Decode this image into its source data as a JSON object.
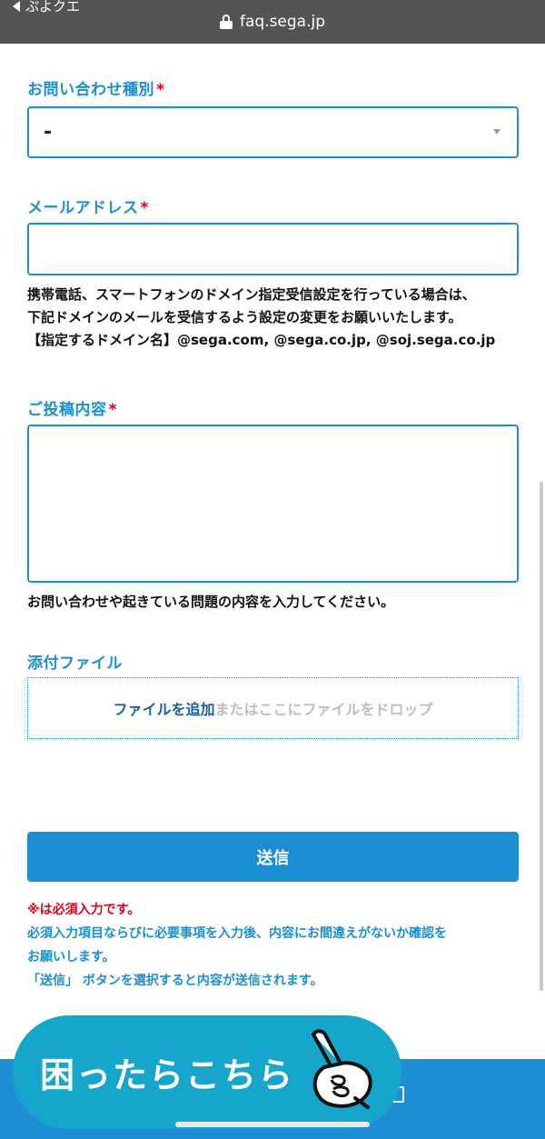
{
  "browser": {
    "back_label": "ぷよクエ",
    "url": "faq.sega.jp"
  },
  "form": {
    "inquiry_type": {
      "label": "お問い合わせ種別",
      "required_mark": "*",
      "selected_value": "-"
    },
    "email": {
      "label": "メールアドレス",
      "required_mark": "*",
      "value": "",
      "help_lines": [
        "携帯電話、スマートフォンのドメイン指定受信設定を行っている場合は、",
        "下記ドメインのメールを受信するよう設定の変更をお願いいたします。",
        "【指定するドメイン名】@sega.com, @sega.co.jp, @soj.sega.co.jp"
      ]
    },
    "message": {
      "label": "ご投稿内容",
      "required_mark": "*",
      "value": "",
      "help": "お問い合わせや起きている問題の内容を入力してください。"
    },
    "attachment": {
      "label": "添付ファイル",
      "add_link": "ファイルを追加",
      "drop_hint": "またはここにファイルをドロップ"
    },
    "submit_label": "送信"
  },
  "notes": {
    "required_note": "※は必須入力です。",
    "line2": "必須入力項目ならびに必要事項を入力後、内容にお間違えがないか確認を",
    "line3": "お願いします。",
    "line4": "「送信」 ボタンを選択すると内容が送信されます。"
  },
  "help_widget": {
    "label": "困ったらこちら",
    "icon": "pointing-hand-icon"
  },
  "colors": {
    "accent": "#1a90cf",
    "required": "#e0001b",
    "button": "#1a8fd4",
    "bubble": "#16a6cc",
    "topbar": "#545454"
  }
}
